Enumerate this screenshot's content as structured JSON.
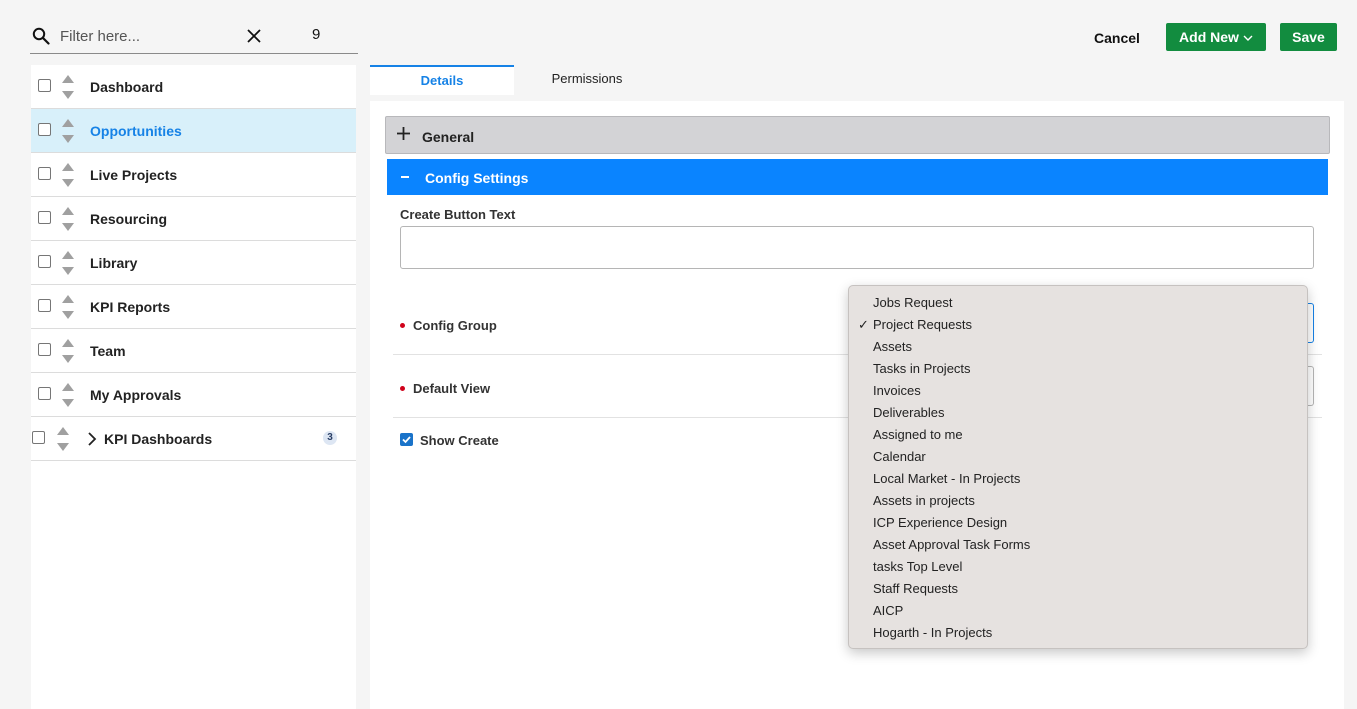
{
  "filter": {
    "placeholder": "Filter here...",
    "count": "9"
  },
  "nav": {
    "items": [
      {
        "label": "Dashboard"
      },
      {
        "label": "Opportunities"
      },
      {
        "label": "Live Projects"
      },
      {
        "label": "Resourcing"
      },
      {
        "label": "Library"
      },
      {
        "label": "KPI Reports"
      },
      {
        "label": "Team"
      },
      {
        "label": "My Approvals"
      }
    ],
    "group": {
      "label": "KPI Dashboards",
      "badge": "3"
    }
  },
  "actions": {
    "cancel": "Cancel",
    "add_new": "Add New",
    "save": "Save"
  },
  "tabs": {
    "details": "Details",
    "permissions": "Permissions"
  },
  "sections": {
    "general": "General",
    "config": "Config Settings"
  },
  "fields": {
    "create_button_text": "Create Button Text",
    "config_group": "Config Group",
    "default_view": "Default View",
    "show_create": "Show Create"
  },
  "dropdown": {
    "options": [
      "Jobs Request",
      "Project Requests",
      "Assets",
      "Tasks in Projects",
      "Invoices",
      "Deliverables",
      "Assigned to me",
      "Calendar",
      "Local Market - In Projects",
      "Assets in projects",
      "ICP Experience Design",
      "Asset Approval Task Forms",
      "tasks Top Level",
      "Staff Requests",
      "AICP",
      "Hogarth - In Projects"
    ],
    "check_mark": "✓"
  },
  "colors": {
    "accent": "#1682e6",
    "config_header": "#0a84ff",
    "green": "#128c3f",
    "active_row": "#d8f0fa"
  }
}
